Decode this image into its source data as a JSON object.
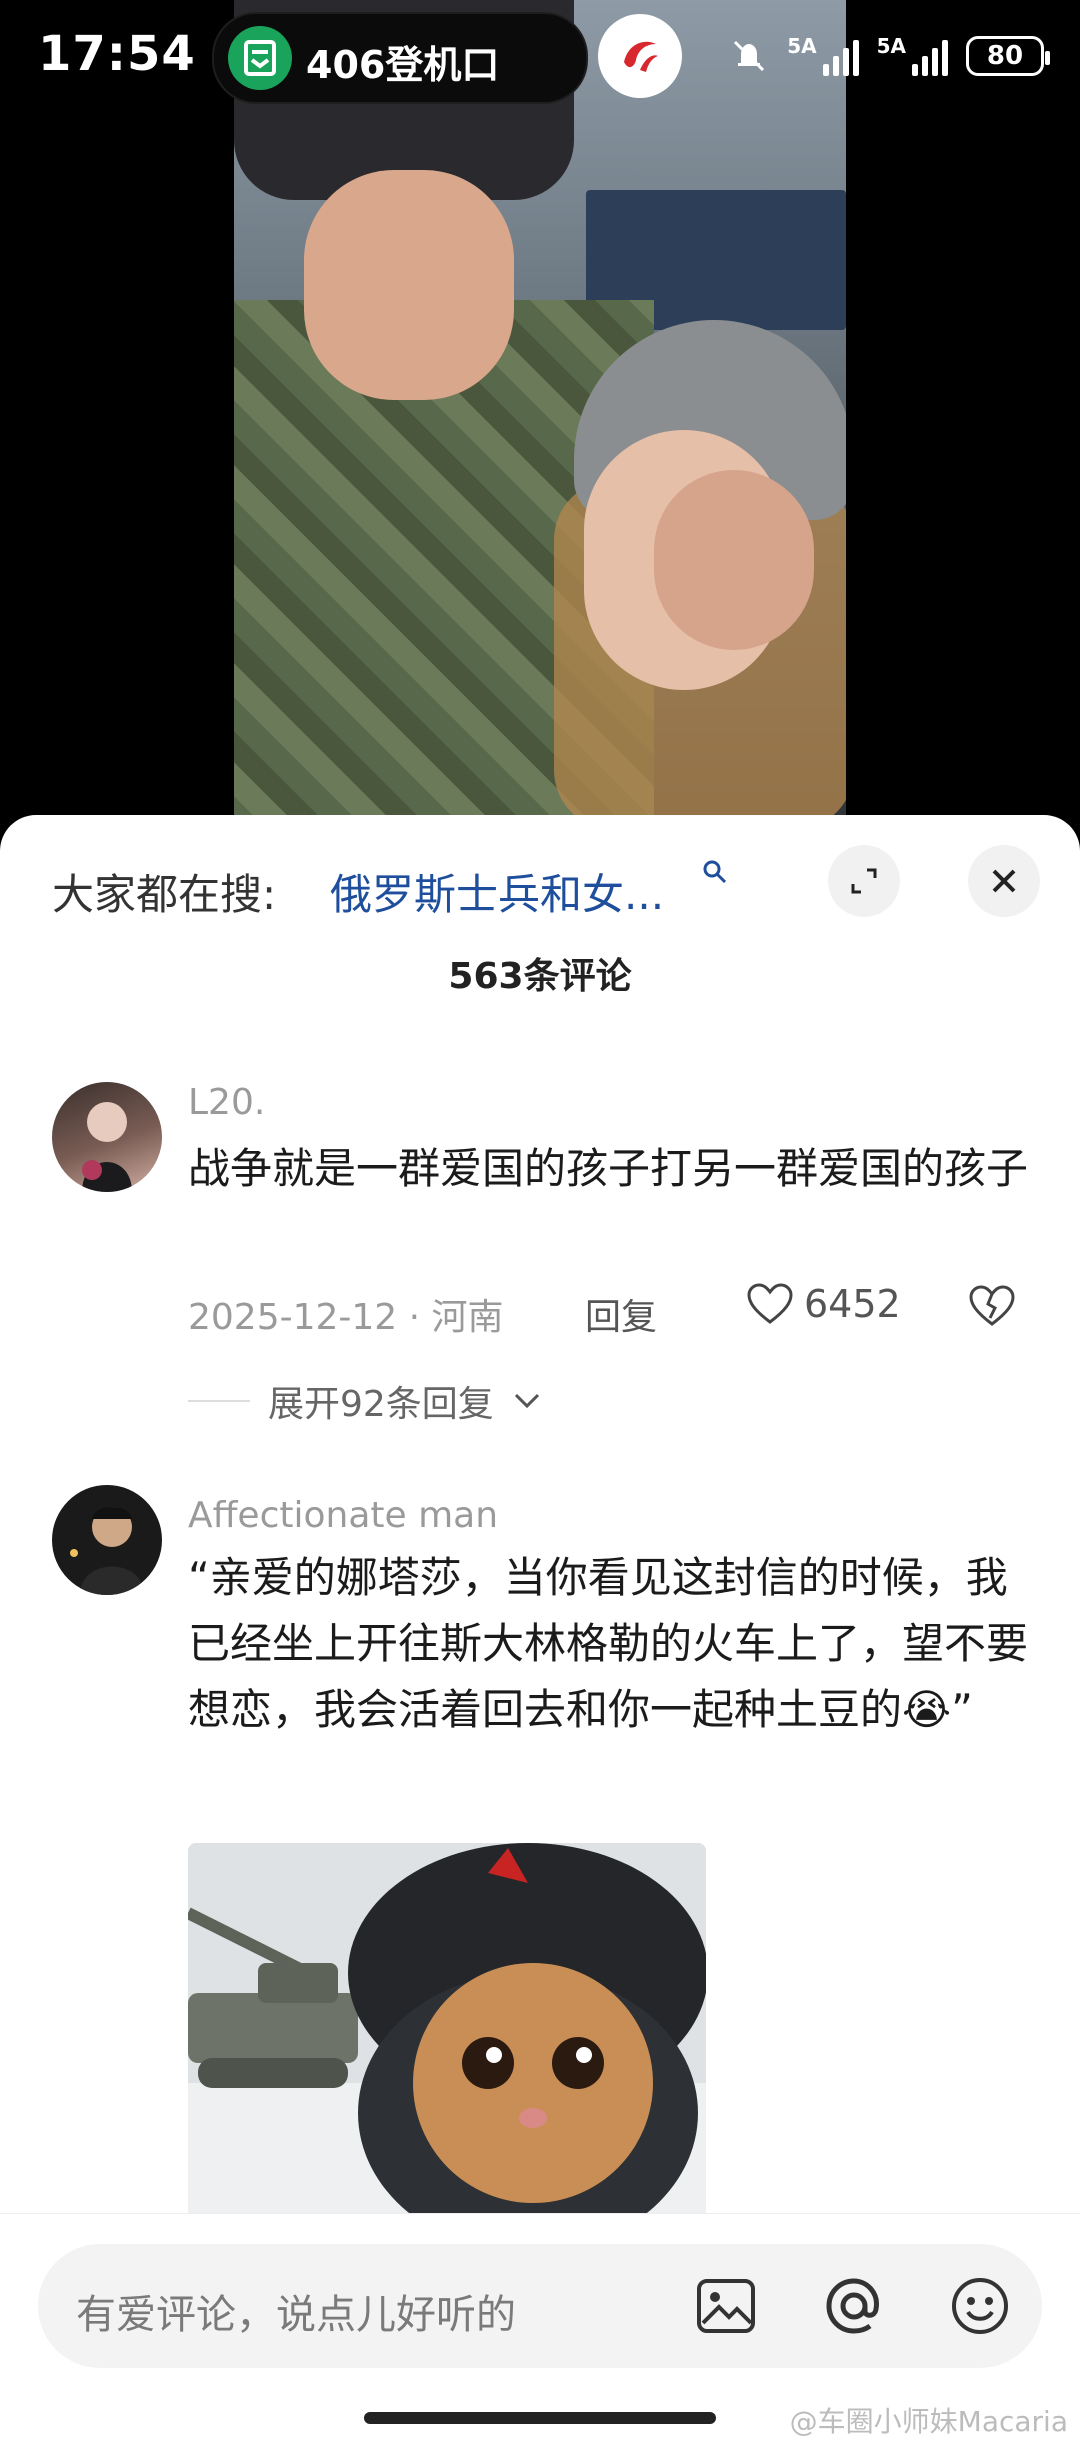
{
  "status_bar": {
    "time": "17:54",
    "live_activity_text": "406登机口",
    "signal_1_label": "5A",
    "signal_2_label": "5A",
    "battery": "80"
  },
  "sheet": {
    "search_prefix": "大家都在搜:",
    "search_term": "俄罗斯士兵和女...",
    "comment_count": "563条评论"
  },
  "comments": [
    {
      "username": "L20.",
      "text": "战争就是一群爱国的孩子打另一群爱国的孩子",
      "date_location": "2025-12-12 · 河南",
      "reply_label": "回复",
      "likes": "6452",
      "expand_label": "展开92条回复"
    },
    {
      "username": "Affectionate man",
      "text": "“亲爱的娜塔莎，当你看见这封信的时候，我已经坐上开往斯大林格勒的火车上了，望不要想恋，我会活着回去和你一起种土豆的😭”"
    }
  ],
  "input": {
    "placeholder": "有爱评论，说点儿好听的"
  },
  "watermark": "@车圈小师妹Macaria",
  "icons": [
    "document-icon",
    "airline-logo",
    "mute-icon",
    "signal-icon",
    "battery-icon",
    "search-icon",
    "expand-icon",
    "close-icon",
    "heart-icon",
    "broken-heart-icon",
    "chevron-down-icon",
    "image-icon",
    "at-icon",
    "emoji-icon"
  ],
  "colors": {
    "search_term": "#1f4f9c",
    "island_green": "#1aa35a",
    "airline_red": "#d7282f"
  }
}
